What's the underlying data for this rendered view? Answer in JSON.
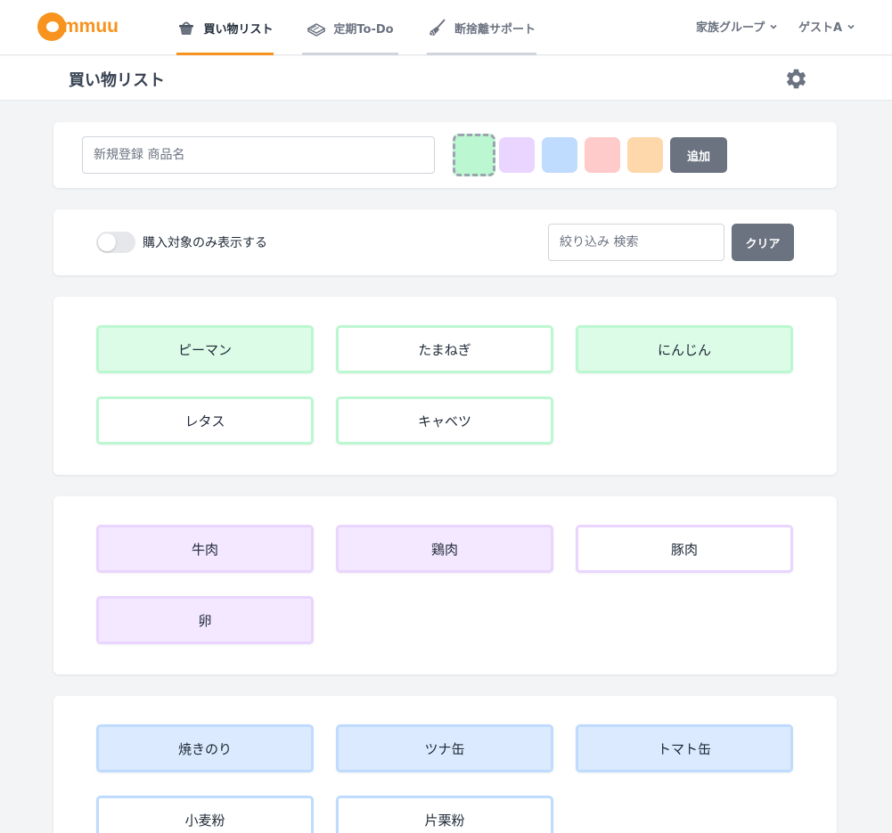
{
  "app": {
    "logo_text": "mmuu"
  },
  "nav": {
    "tabs": [
      {
        "label": "買い物リスト",
        "icon": "basket-icon",
        "active": true
      },
      {
        "label": "定期To-Do",
        "icon": "book-icon",
        "active": false
      },
      {
        "label": "断捨離サポート",
        "icon": "broom-icon",
        "active": false
      }
    ],
    "family_group": "家族グループ",
    "user": "ゲストA"
  },
  "header": {
    "title": "買い物リスト",
    "settings_icon": "gear-icon"
  },
  "add_form": {
    "placeholder": "新規登録 商品名",
    "value": "",
    "colors": [
      "#bbf7d0",
      "#e9d5ff",
      "#bfdbfe",
      "#fecaca",
      "#fed7aa"
    ],
    "selected_color": 0,
    "add_label": "追加"
  },
  "filter": {
    "toggle_label": "購入対象のみ表示する",
    "toggle_on": false,
    "search_placeholder": "絞り込み 検索",
    "clear_label": "クリア"
  },
  "groups": [
    {
      "color": "green",
      "border": "#bbf7d0",
      "fill": "#dcfce7",
      "items": [
        {
          "label": "ピーマン",
          "active": true
        },
        {
          "label": "たまねぎ",
          "active": false
        },
        {
          "label": "にんじん",
          "active": true
        },
        {
          "label": "レタス",
          "active": false
        },
        {
          "label": "キャベツ",
          "active": false
        }
      ]
    },
    {
      "color": "purple",
      "border": "#e9d5ff",
      "fill": "#f3e8ff",
      "items": [
        {
          "label": "牛肉",
          "active": true
        },
        {
          "label": "鶏肉",
          "active": true
        },
        {
          "label": "豚肉",
          "active": false
        },
        {
          "label": "卵",
          "active": true
        }
      ]
    },
    {
      "color": "blue",
      "border": "#bfdbfe",
      "fill": "#dbeafe",
      "items": [
        {
          "label": "焼きのり",
          "active": true
        },
        {
          "label": "ツナ缶",
          "active": true
        },
        {
          "label": "トマト缶",
          "active": true
        },
        {
          "label": "小麦粉",
          "active": false
        },
        {
          "label": "片栗粉",
          "active": false
        }
      ]
    }
  ]
}
